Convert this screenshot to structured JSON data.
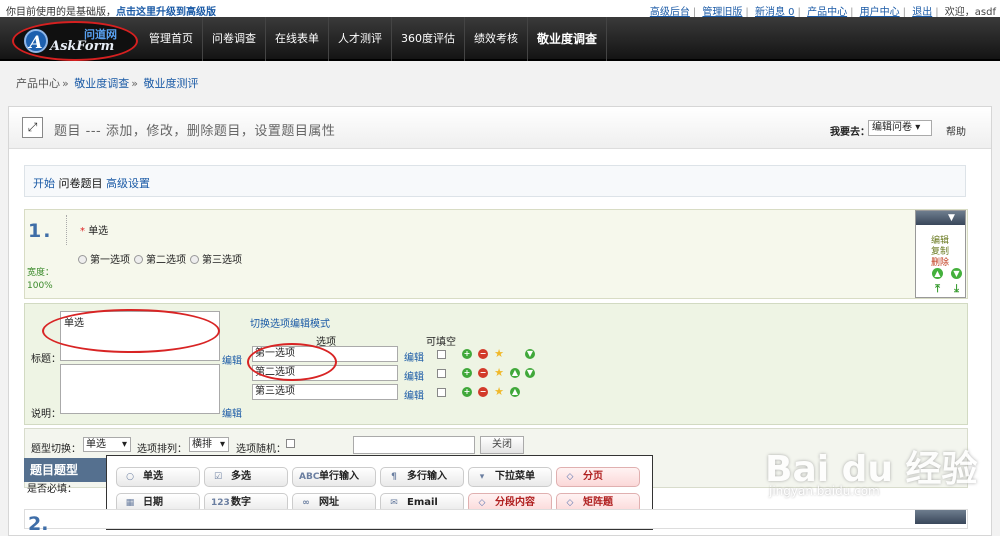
{
  "topbar": {
    "notice": "你目前使用的是基础版，",
    "upgrade": "点击这里升级到高级版",
    "links": [
      "高级后台",
      "管理旧版",
      "新消息 0",
      "产品中心",
      "用户中心",
      "退出"
    ],
    "welcome": "欢迎，asdf"
  },
  "logo": {
    "cn": "问道网",
    "en": "AskForm",
    "mark": "A"
  },
  "nav": [
    "管理首页",
    "问卷调查",
    "在线表单",
    "人才测评",
    "360度评估",
    "绩效考核",
    "敬业度调查"
  ],
  "breadcrumb": [
    "产品中心",
    "敬业度调查",
    "敬业度测评"
  ],
  "header": {
    "title": "题目 --- 添加，修改，删除题目，设置题目属性",
    "goto_label": "我要去：",
    "goto_value": "编辑问卷",
    "help": "帮助"
  },
  "tabs": [
    "开始",
    "问卷题目",
    "高级设置"
  ],
  "question": {
    "num": "1.",
    "required": "*",
    "title": "单选",
    "options": [
      "第一选项",
      "第二选项",
      "第三选项"
    ],
    "width_label": "宽度：",
    "width_value": "100%"
  },
  "side": {
    "edit": "编辑",
    "copy": "复制",
    "delete": "删除"
  },
  "editor": {
    "title_label": "标题：",
    "desc_label": "说明：",
    "title_value": "单选",
    "edit": "编辑",
    "switch_mode": "切换选项编辑模式",
    "col_option": "选项",
    "col_fill": "可填空",
    "options": [
      "第一选项",
      "第二选项",
      "第三选项"
    ]
  },
  "switchrow": {
    "type_label": "题型切换：",
    "type_value": "单选",
    "arr_label": "选项排列：",
    "arr_value": "横排",
    "rand_label": "选项随机：",
    "close": "关闭",
    "required": "是否必填："
  },
  "palette": {
    "title": "题目题型",
    "row1": [
      {
        "icon": "○",
        "label": "单选"
      },
      {
        "icon": "☑",
        "label": "多选"
      },
      {
        "icon": "ABC",
        "label": "单行输入"
      },
      {
        "icon": "¶",
        "label": "多行输入"
      },
      {
        "icon": "▾",
        "label": "下拉菜单"
      },
      {
        "icon": "◇",
        "label": "分页"
      }
    ],
    "row2": [
      {
        "icon": "▦",
        "label": "日期"
      },
      {
        "icon": "123",
        "label": "数字"
      },
      {
        "icon": "∞",
        "label": "网址"
      },
      {
        "icon": "✉",
        "label": "Email"
      },
      {
        "icon": "◇",
        "label": "分段内容"
      },
      {
        "icon": "◇",
        "label": "矩阵题"
      }
    ]
  },
  "q2": {
    "num": "2."
  },
  "watermark": {
    "main": "Bai du 经验",
    "sub": "jingyan.baidu.com"
  }
}
